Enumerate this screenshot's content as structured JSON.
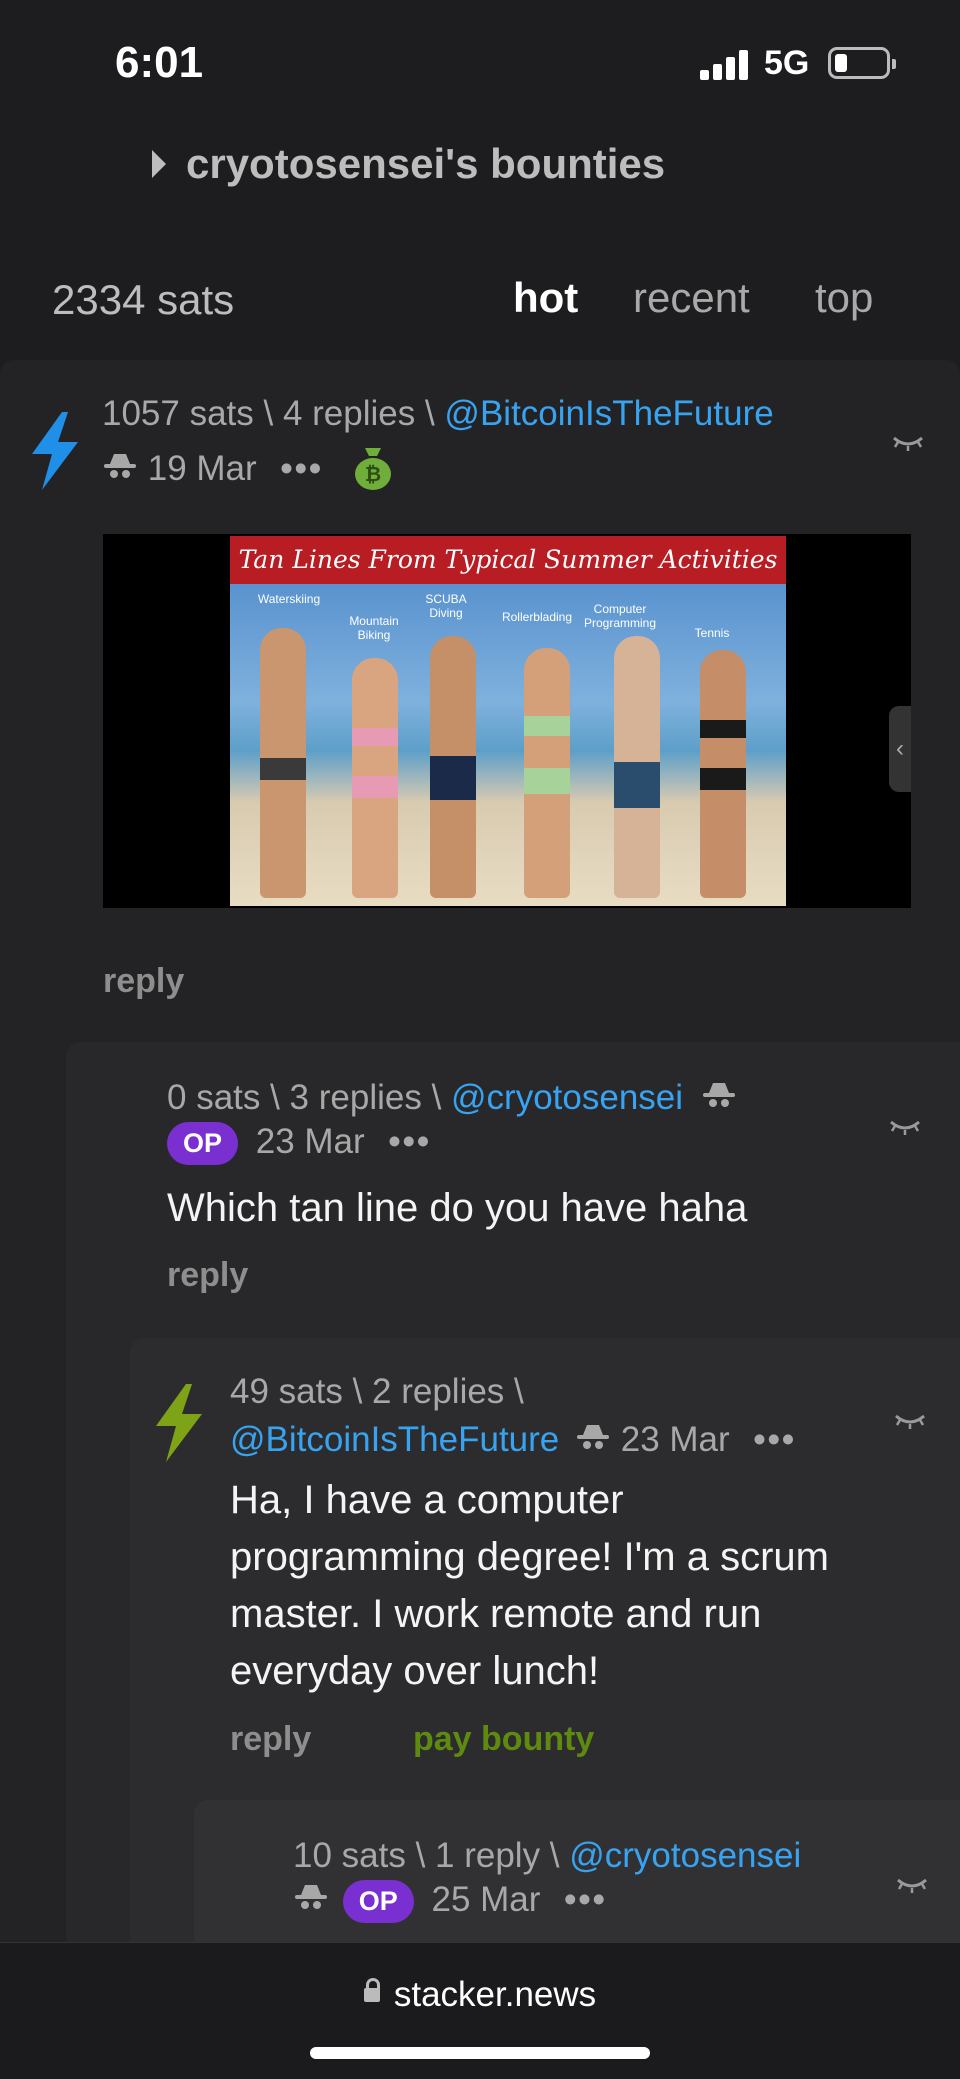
{
  "status_bar": {
    "time": "6:01",
    "network": "5G"
  },
  "header": {
    "title": "cryotosensei's bounties"
  },
  "summary": {
    "total_sats": "2334 sats"
  },
  "sort_tabs": [
    {
      "label": "hot",
      "active": true
    },
    {
      "label": "recent",
      "active": false
    },
    {
      "label": "top",
      "active": false
    }
  ],
  "comments": [
    {
      "meta": "1057 sats \\ 4 replies \\ ",
      "author": "@BitcoinIsTheFuture",
      "date": "19 Mar",
      "more": "•••",
      "media": {
        "banner": "Tan Lines From Typical Summer Activities",
        "labels": [
          "Waterskiing",
          "Mountain Biking",
          "SCUBA Diving",
          "Rollerblading",
          "Computer Programming",
          "Tennis"
        ]
      },
      "reply": "reply",
      "bolt_color": "#1f8fe8"
    },
    {
      "meta": "0 sats \\ 3 replies \\ ",
      "author": "@cryotosensei",
      "badge": "OP",
      "date": "23 Mar",
      "more": "•••",
      "text": "Which tan line do you have haha",
      "reply": "reply"
    },
    {
      "meta": "49 sats \\ 2 replies \\",
      "author": "@BitcoinIsTheFuture",
      "date": "23 Mar",
      "more": "•••",
      "text_lines": [
        "Ha, I have a computer",
        "programming degree! I'm a scrum",
        "master. I work remote and run",
        "everyday over lunch!"
      ],
      "reply": "reply",
      "pay_bounty": "pay bounty",
      "bolt_color": "#7fa316"
    },
    {
      "meta": "10 sats \\ 1 reply \\ ",
      "author": "@cryotosensei",
      "badge": "OP",
      "date": "25 Mar",
      "more": "•••"
    }
  ],
  "browser": {
    "url": "stacker.news"
  }
}
